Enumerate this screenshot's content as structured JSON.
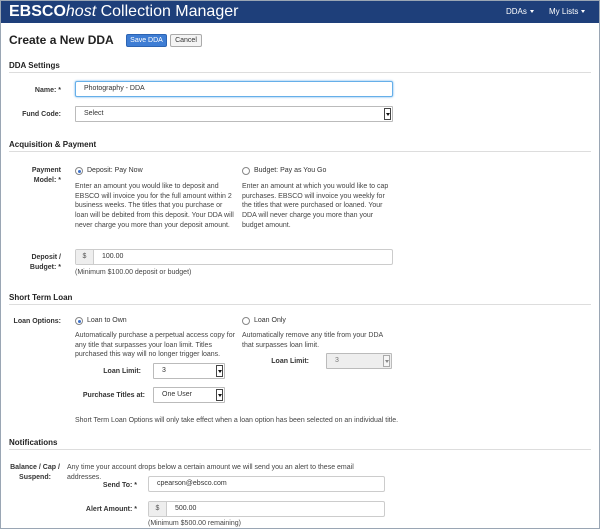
{
  "header": {
    "brand_ebsco": "EBSCO",
    "brand_host": "host",
    "brand_rest": " Collection Manager",
    "nav": [
      {
        "label": "DDAs"
      },
      {
        "label": "My Lists"
      }
    ],
    "bg_color": "#1e3f7a"
  },
  "page": {
    "title": "Create a New DDA",
    "save_label": "Save DDA",
    "cancel_label": "Cancel",
    "accent_color": "#3e7dd4"
  },
  "dda_settings": {
    "heading": "DDA Settings",
    "name_label": "Name: *",
    "name_value": "Photography - DDA",
    "fund_label": "Fund Code:",
    "fund_value": "Select"
  },
  "acquisition": {
    "heading": "Acquisition & Payment",
    "model_label": "Payment Model: *",
    "option_deposit": "Deposit: Pay Now",
    "deposit_desc": "Enter an amount you would like to deposit and EBSCO will invoice you for the full amount within 2 business weeks. The titles that you purchase or loan will be debited from this deposit. Your DDA will never charge you more than your deposit amount.",
    "option_budget": "Budget: Pay as You Go",
    "budget_desc": "Enter an amount at which you would like to cap purchases. EBSCO will invoice you weekly for the titles that were purchased or loaned. Your DDA will never charge you more than your budget amount.",
    "amount_label": "Deposit / Budget: *",
    "currency": "$",
    "amount_value": "100.00",
    "amount_note": "(Minimum $100.00 deposit or budget)"
  },
  "short_term_loan": {
    "heading": "Short Term Loan",
    "options_label": "Loan Options:",
    "option_own": "Loan to Own",
    "own_desc": "Automatically purchase a perpetual access copy for any title that surpasses your loan limit. Titles purchased this way will no longer trigger loans.",
    "option_only": "Loan Only",
    "only_desc": "Automatically remove any title from your DDA that surpasses loan limit.",
    "loan_limit_label": "Loan Limit:",
    "loan_limit_value": "3",
    "purchase_label": "Purchase Titles at:",
    "purchase_value": "One User",
    "loan_only_limit_label": "Loan Limit:",
    "loan_only_limit_value": "3",
    "footer_note": "Short Term Loan Options will only take effect when a loan option has been selected on an individual title."
  },
  "notifications": {
    "heading": "Notifications",
    "balance_label": "Balance / Cap / Suspend:",
    "balance_desc": "Any time your account drops below a certain amount we will send you an alert to these email addresses.",
    "send_to_label": "Send To: *",
    "send_to_value": "cpearson@ebsco.com",
    "alert_label": "Alert Amount: *",
    "currency": "$",
    "alert_value": "500.00",
    "alert_note": "(Minimum $500.00 remaining)"
  }
}
